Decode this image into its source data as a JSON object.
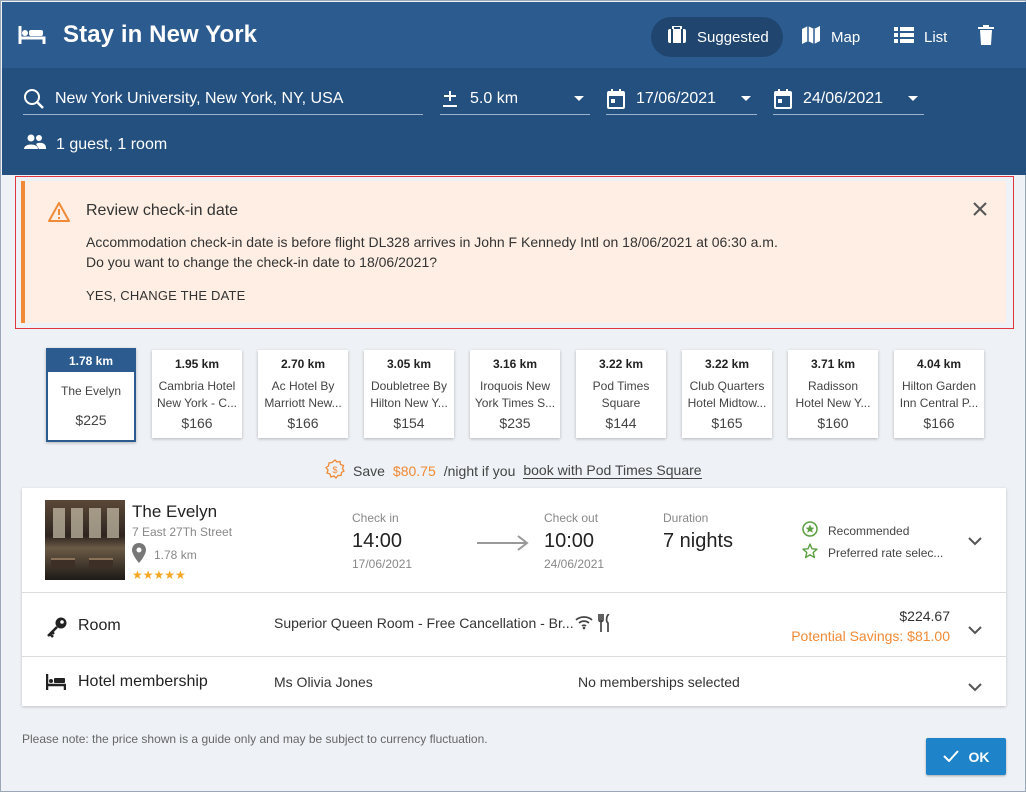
{
  "header": {
    "title": "Stay in New York",
    "buttons": [
      {
        "label": "Suggested",
        "icon": "suitcase-icon",
        "active": true
      },
      {
        "label": "Map",
        "icon": "map-icon"
      },
      {
        "label": "List",
        "icon": "list-icon"
      }
    ],
    "delete_icon": "trash-icon"
  },
  "search": {
    "location": "New York University, New York, NY, USA",
    "radius": "5.0 km",
    "checkin": "17/06/2021",
    "checkout": "24/06/2021",
    "guests": "1 guest, 1 room"
  },
  "alert": {
    "title": "Review check-in date",
    "line1": "Accommodation check-in date is before flight DL328 arrives in John F Kennedy Intl on 18/06/2021 at 06:30 a.m.",
    "line2": "Do you want to change the check-in date to 18/06/2021?",
    "action": "YES, CHANGE THE DATE"
  },
  "hotels": [
    {
      "dist": "1.78 km",
      "name1": "The Evelyn",
      "name2": "",
      "price": "$225",
      "selected": true
    },
    {
      "dist": "1.95 km",
      "name1": "Cambria Hotel",
      "name2": "New York - C...",
      "price": "$166"
    },
    {
      "dist": "2.70 km",
      "name1": "Ac Hotel By",
      "name2": "Marriott New...",
      "price": "$166"
    },
    {
      "dist": "3.05 km",
      "name1": "Doubletree By",
      "name2": "Hilton New Y...",
      "price": "$154"
    },
    {
      "dist": "3.16 km",
      "name1": "Iroquois New",
      "name2": "York Times S...",
      "price": "$235"
    },
    {
      "dist": "3.22 km",
      "name1": "Pod Times",
      "name2": "Square",
      "price": "$144"
    },
    {
      "dist": "3.22 km",
      "name1": "Club Quarters",
      "name2": "Hotel Midtow...",
      "price": "$165"
    },
    {
      "dist": "3.71 km",
      "name1": "Radisson",
      "name2": "Hotel New Y...",
      "price": "$160"
    },
    {
      "dist": "4.04 km",
      "name1": "Hilton Garden",
      "name2": "Inn Central P...",
      "price": "$166"
    }
  ],
  "savings": {
    "prefix": "Save",
    "amount": "$80.75",
    "middle": "/night if you",
    "link": "book with Pod Times Square"
  },
  "details": {
    "hotel_name": "The Evelyn",
    "address": "7 East 27Th Street",
    "distance": "1.78 km",
    "stars": "★★★★★",
    "checkin_label": "Check in",
    "checkin_time": "14:00",
    "checkin_date": "17/06/2021",
    "checkout_label": "Check out",
    "checkout_time": "10:00",
    "checkout_date": "24/06/2021",
    "duration_label": "Duration",
    "duration": "7 nights",
    "recommended": "Recommended",
    "preferred": "Preferred rate selec...",
    "room_label": "Room",
    "room_value": "Superior Queen Room - Free Cancellation - Br...",
    "room_price": "$224.67",
    "room_savings": "Potential Savings: $81.00",
    "membership_label": "Hotel membership",
    "member_name": "Ms Olivia Jones",
    "membership_status": "No memberships selected"
  },
  "footer": {
    "note": "Please note: the price shown is a guide only and may be subject to currency fluctuation.",
    "ok": "OK"
  },
  "colors": {
    "header": "#2b5b8f",
    "search_bar": "#24507f",
    "accent_orange": "#f08a36",
    "alert_bg": "#feeee3",
    "ok_button": "#1f83c9"
  }
}
